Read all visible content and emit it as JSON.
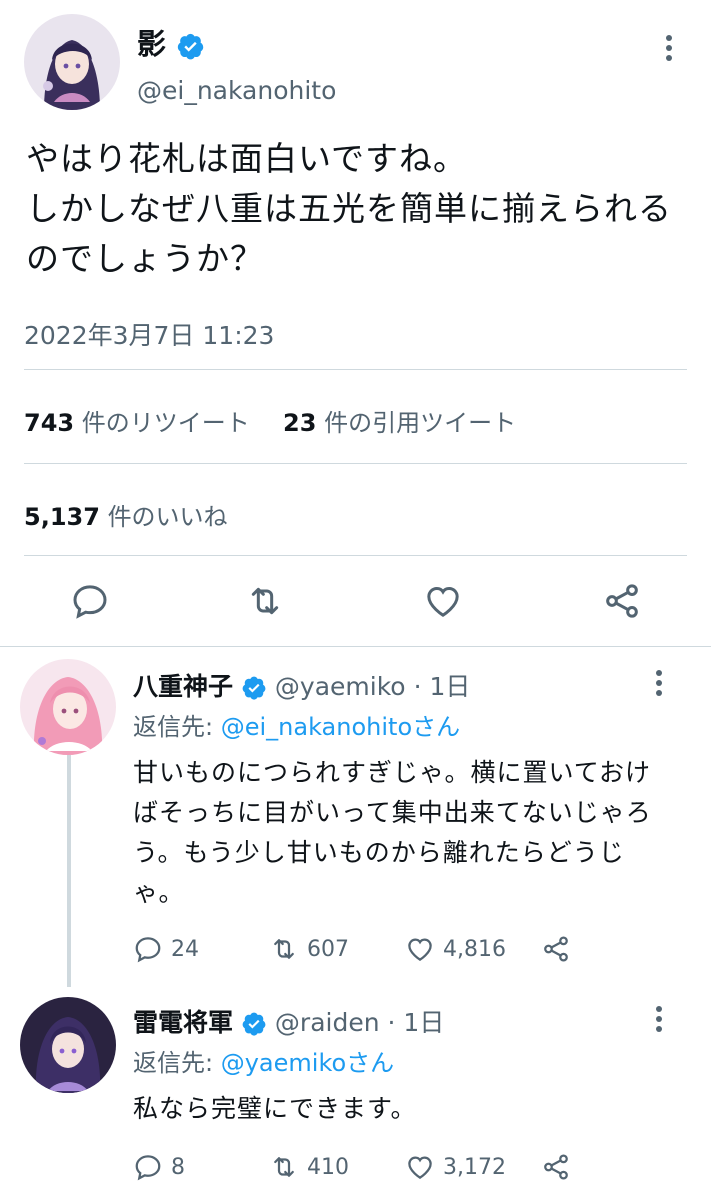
{
  "main_tweet": {
    "author": {
      "display_name": "影",
      "handle": "@ei_nakanohito",
      "verified": true,
      "avatar": "avatar-raiden-portrait"
    },
    "text": "やはり花札は面白いですね。\nしかしなぜ八重は五光を簡単に揃えられる\nのでしょうか？",
    "timestamp": "2022年3月7日 11:23",
    "retweets_count": "743",
    "retweets_label": "件のリツイート",
    "quotes_count": "23",
    "quotes_label": "件の引用ツイート",
    "likes_count": "5,137",
    "likes_label": "件のいいね",
    "actions": [
      "reply-icon",
      "retweet-icon",
      "like-icon",
      "share-icon"
    ]
  },
  "replies": [
    {
      "display_name": "八重神子",
      "handle": "@yaemiko",
      "time": "· 1日",
      "verified": true,
      "avatar": "avatar-yae-portrait",
      "reply_to_prefix": "返信先: ",
      "reply_to_mention": "@ei_nakanohito",
      "reply_to_suffix": "さん",
      "text": "甘いものにつられすぎじゃ。横に置いておけ\nばそっちに目がいって集中出来てないじゃろ\nう。もう少し甘いものから離れたらどうじ\nゃ。",
      "reply_count": "24",
      "retweet_count": "607",
      "like_count": "4,816"
    },
    {
      "display_name": "雷電将軍",
      "handle": "@raiden",
      "time": "· 1日",
      "verified": true,
      "avatar": "avatar-shogun-portrait",
      "reply_to_prefix": "返信先: ",
      "reply_to_mention": "@yaemiko",
      "reply_to_suffix": "さん",
      "text": "私なら完璧にできます。",
      "reply_count": "8",
      "retweet_count": "410",
      "like_count": "3,172"
    }
  ],
  "colors": {
    "accent": "#1d9bf0",
    "secondary_text": "#536471",
    "divider": "#cfd9de"
  }
}
